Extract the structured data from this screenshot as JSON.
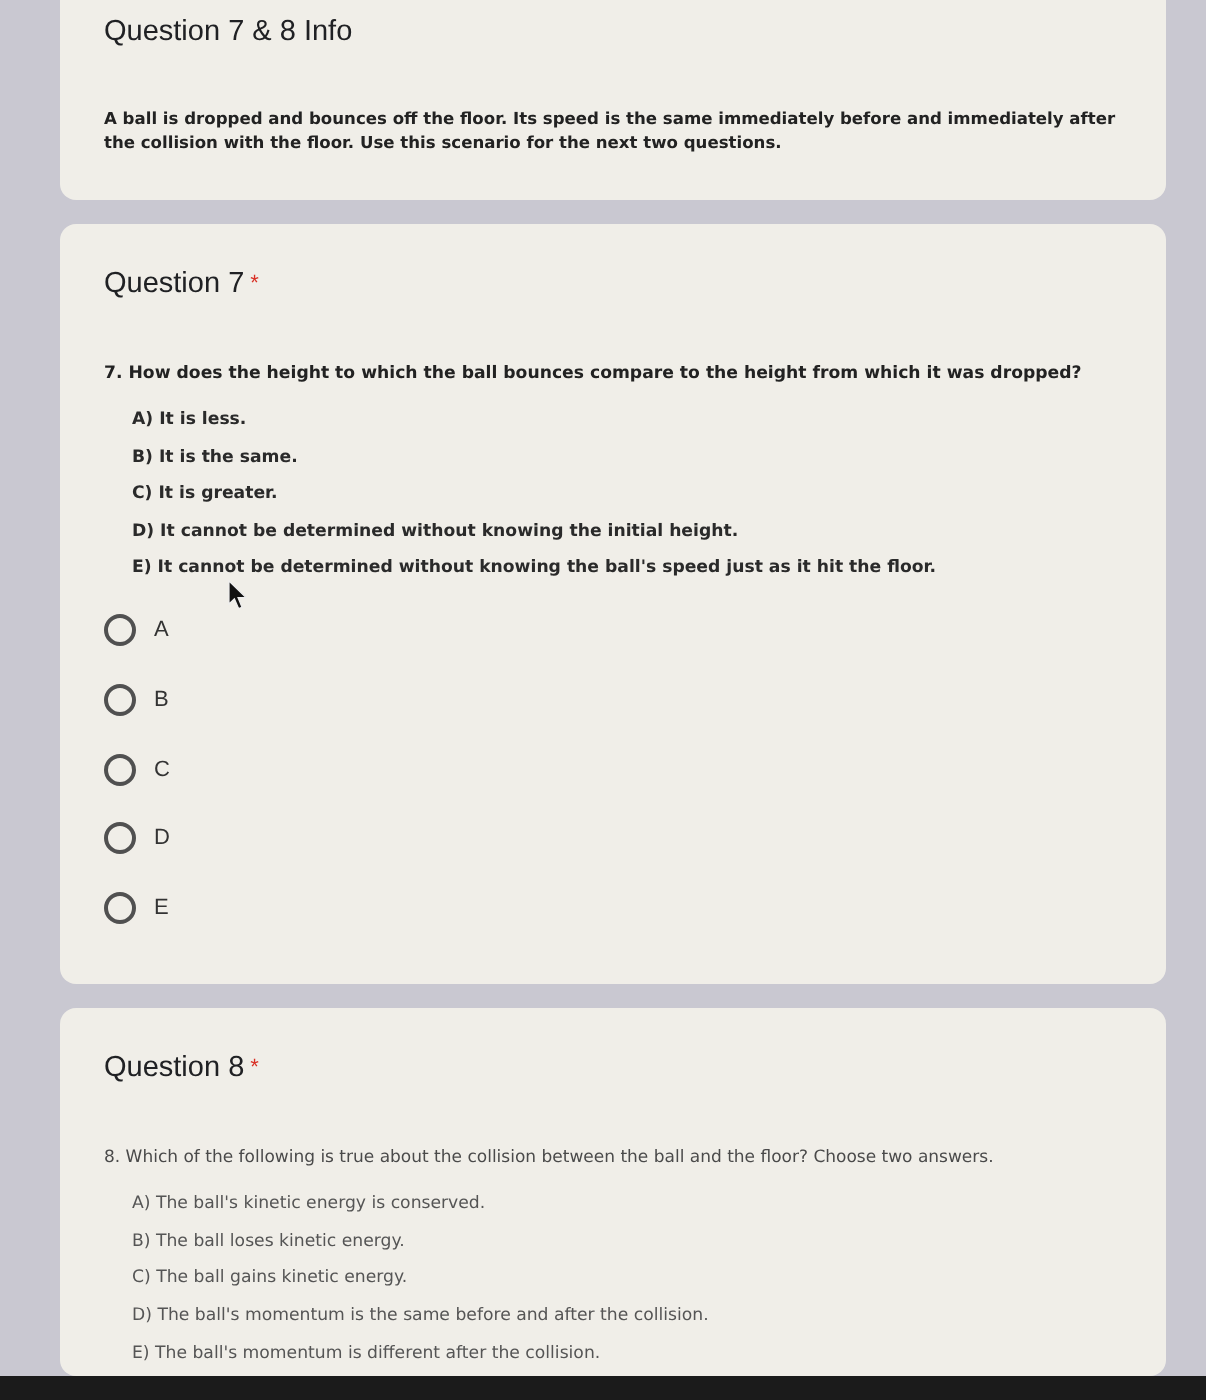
{
  "sections": [
    {
      "kind": "info",
      "title": "Question 7 & 8 Info",
      "description": "A ball is dropped and bounces off the floor. Its speed is the same immediately before and immediately after the collision with the floor. Use this scenario for the next two questions."
    },
    {
      "kind": "question",
      "title": "Question 7",
      "required_mark": "*",
      "prompt": "7. How does the height to which the ball bounces compare to the height from which it was dropped?",
      "choices": [
        "A) It is less.",
        "B) It is the same.",
        "C) It is greater.",
        "D) It cannot be determined without knowing the initial height.",
        "E) It cannot be determined without knowing the ball's speed just as it hit the floor."
      ],
      "options": [
        {
          "label": "A",
          "selected": false
        },
        {
          "label": "B",
          "selected": false
        },
        {
          "label": "C",
          "selected": false
        },
        {
          "label": "D",
          "selected": false
        },
        {
          "label": "E",
          "selected": false
        }
      ]
    },
    {
      "kind": "question",
      "title": "Question 8",
      "required_mark": "*",
      "prompt": "8. Which of the following is true about the collision between the ball and the floor? Choose two answers.",
      "choices": [
        "A) The ball's kinetic energy is conserved.",
        "B) The ball loses kinetic energy.",
        "C) The ball gains kinetic energy.",
        "D) The ball's momentum is the same before and after the collision.",
        "E) The ball's momentum is different after the collision."
      ]
    }
  ]
}
